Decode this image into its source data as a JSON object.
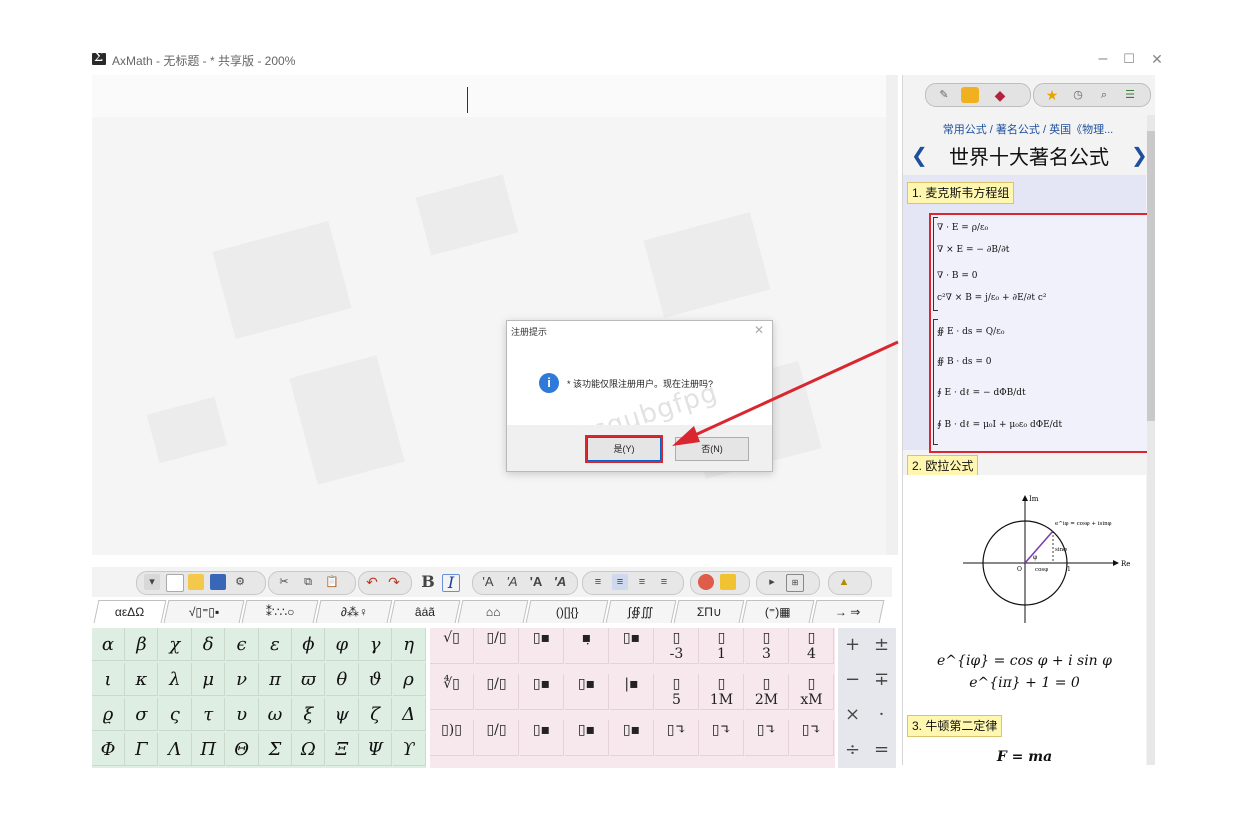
{
  "window": {
    "title": "AxMath - 无标题 - * 共享版 - 200%",
    "min_label": "–",
    "max_label": "☐",
    "close_label": "✕"
  },
  "dialog": {
    "title": "注册提示",
    "close_label": "✕",
    "message": "* 该功能仅限注册用户。现在注册吗?",
    "yes_label": "是(Y)",
    "no_label": "否(N)",
    "watermark": "ahhcqubgfpg"
  },
  "right_panel": {
    "breadcrumb": "常用公式 / 著名公式 / 英国《物理...",
    "heading": "世界十大著名公式",
    "prev_label": "❮",
    "next_label": "❯",
    "section1_label": "1. 麦克斯韦方程组",
    "section2_label": "2. 欧拉公式",
    "section3_label": "3. 牛顿第二定律",
    "maxwell": [
      "∇ · E = ρ/ε₀",
      "∇ × E = − ∂B/∂t",
      "∇ · B = 0",
      "c²∇ × B = j/ε₀ + ∂E/∂t c²",
      "∯ E · ds = Q/ε₀",
      "∯ B · ds = 0",
      "∮ E · dℓ = − dΦB/dt",
      "∮ B · dℓ = μ₀I + μ₀ε₀ dΦE/dt"
    ],
    "euler_diagram": {
      "im_label": "Im",
      "re_label": "Re",
      "formula_label": "e^iφ = cosφ + isinφ",
      "sin_label": "sinφ",
      "cos_label": "cosφ",
      "phi_label": "φ",
      "origin_label": "O",
      "one_label": "1"
    },
    "euler_eq1": "e^{iφ} = cos φ + i sin φ",
    "euler_eq2": "e^{iπ} + 1 = 0",
    "newton_eq": "F = ma"
  },
  "toolbar": {
    "bold_label": "B",
    "italic_label": "I",
    "size_labels": [
      "'A",
      "'A",
      "'A",
      "'A"
    ]
  },
  "tabs": [
    "αεΔΩ",
    "√▯⁼▯▪",
    "⁑∵∴○",
    "∂⁂♀",
    "âȧã",
    "⌂⌂",
    "()[]{}",
    "∫∯∭",
    "ΣΠ∪",
    "(⁼)▦",
    "→ ⇒"
  ],
  "greek_rows": [
    [
      "α",
      "β",
      "χ",
      "δ",
      "ϵ",
      "ε",
      "ϕ",
      "φ",
      "γ",
      "η"
    ],
    [
      "ι",
      "κ",
      "λ",
      "μ",
      "ν",
      "π",
      "ϖ",
      "θ",
      "ϑ",
      "ρ"
    ],
    [
      "ϱ",
      "σ",
      "ς",
      "τ",
      "υ",
      "ω",
      "ξ",
      "ψ",
      "ζ",
      "Δ"
    ],
    [
      "Φ",
      "Γ",
      "Λ",
      "Π",
      "Θ",
      "Σ",
      "Ω",
      "Ξ",
      "Ψ",
      "ϒ"
    ]
  ],
  "template_rows": [
    [
      "√▯",
      "▯/▯",
      "▯▪",
      "▪̣",
      "▯▪",
      "▯\n-3",
      "▯\n1",
      "▯\n3",
      "▯\n4"
    ],
    [
      "∜▯",
      "▯/▯",
      "▯▪",
      "▯▪",
      "|▪",
      "▯\n5",
      "▯\n1M",
      "▯\n2M",
      "▯\nxM"
    ],
    [
      "▯)▯",
      "▯/▯",
      "▯▪",
      "▯▪",
      "▯▪",
      "▯↴",
      "▯↴",
      "▯↴",
      "▯↴"
    ]
  ],
  "operator_rows": [
    [
      "+",
      "±"
    ],
    [
      "−",
      "∓"
    ],
    [
      "×",
      "·"
    ],
    [
      "÷",
      "="
    ]
  ]
}
